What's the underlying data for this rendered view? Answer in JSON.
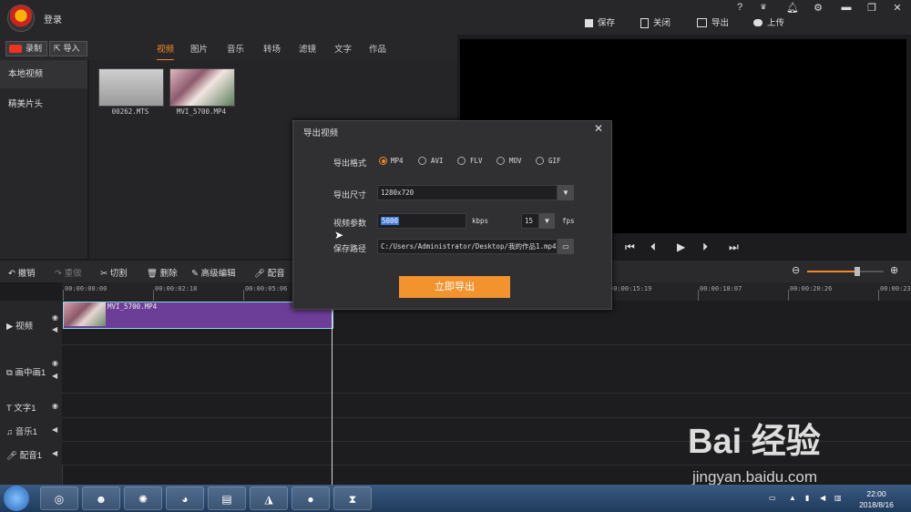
{
  "app": {
    "login": "登录",
    "top_actions": {
      "save": "保存",
      "close": "关闭",
      "export": "导出",
      "upload": "上传"
    },
    "window_icons": [
      "?",
      "VIP",
      "bell",
      "gear",
      "minimize",
      "restore",
      "close"
    ]
  },
  "media": {
    "record": "录制",
    "import": "导入",
    "tabs": [
      "视频",
      "图片",
      "音乐",
      "转场",
      "滤镜",
      "文字",
      "作品"
    ],
    "active_tab": "视频",
    "sidebar": [
      "本地视频",
      "精美片头"
    ],
    "files": [
      "00262.MTS",
      "MVI_5700.MP4"
    ]
  },
  "toolbar": {
    "undo": "撤销",
    "redo": "重做",
    "cut": "切割",
    "delete": "删除",
    "advanced": "高级编辑",
    "dub": "配音"
  },
  "ruler": [
    "00:00:00:00",
    "00:00:02:18",
    "00:00:05:06",
    "00:00:15:19",
    "00:00:18:07",
    "00:00:20:26",
    "00:00:23:"
  ],
  "tracks": [
    "视频",
    "画中画1",
    "文字1",
    "音乐1",
    "配音1"
  ],
  "clip": {
    "name": "MVI_5700.MP4"
  },
  "dialog": {
    "title": "导出视频",
    "format_label": "导出格式",
    "formats": [
      "MP4",
      "AVI",
      "FLV",
      "MOV",
      "GIF"
    ],
    "selected_format": "MP4",
    "size_label": "导出尺寸",
    "size_value": "1280x720",
    "params_label": "视频参数",
    "bitrate": "5000",
    "bitrate_unit": "kbps",
    "fps": "15",
    "fps_unit": "fps",
    "path_label": "保存路径",
    "path_value": "C:/Users/Administrator/Desktop/我的作品1.mp4",
    "export_button": "立即导出"
  },
  "taskbar": {
    "time": "22:00",
    "date": "2018/8/16"
  },
  "watermark": {
    "brand": "Bai 经验",
    "url": "jingyan.baidu.com"
  },
  "colors": {
    "accent": "#f08a24",
    "clip": "#6d3e98",
    "export_button": "#f2932e"
  },
  "zoom_level": 0.67
}
